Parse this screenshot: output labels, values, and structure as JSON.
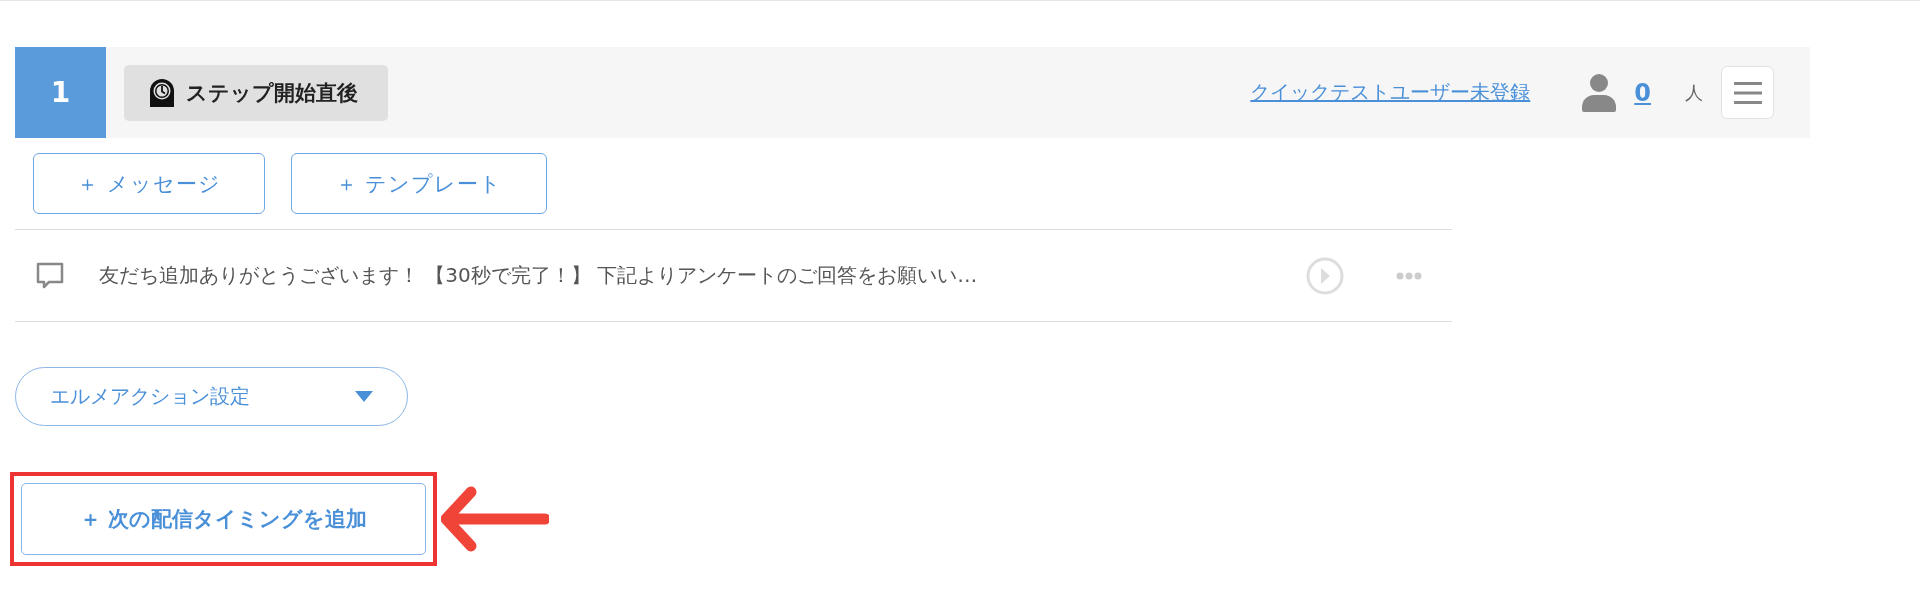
{
  "step": {
    "number": "1",
    "timing_label": "ステップ開始直後",
    "link": "クイックテストユーザー未登録",
    "count": "0",
    "count_unit": "人"
  },
  "add_buttons": [
    {
      "label": "＋ メッセージ"
    },
    {
      "label": "＋ テンプレート"
    }
  ],
  "messages": [
    {
      "text": "友だち追加ありがとうございます！ 【30秒で完了！】 下記よりアンケートのご回答をお願いい…"
    }
  ],
  "action_dropdown": {
    "label": "エルメアクション設定"
  },
  "add_timing_button": {
    "label": "＋ 次の配信タイミングを追加"
  }
}
